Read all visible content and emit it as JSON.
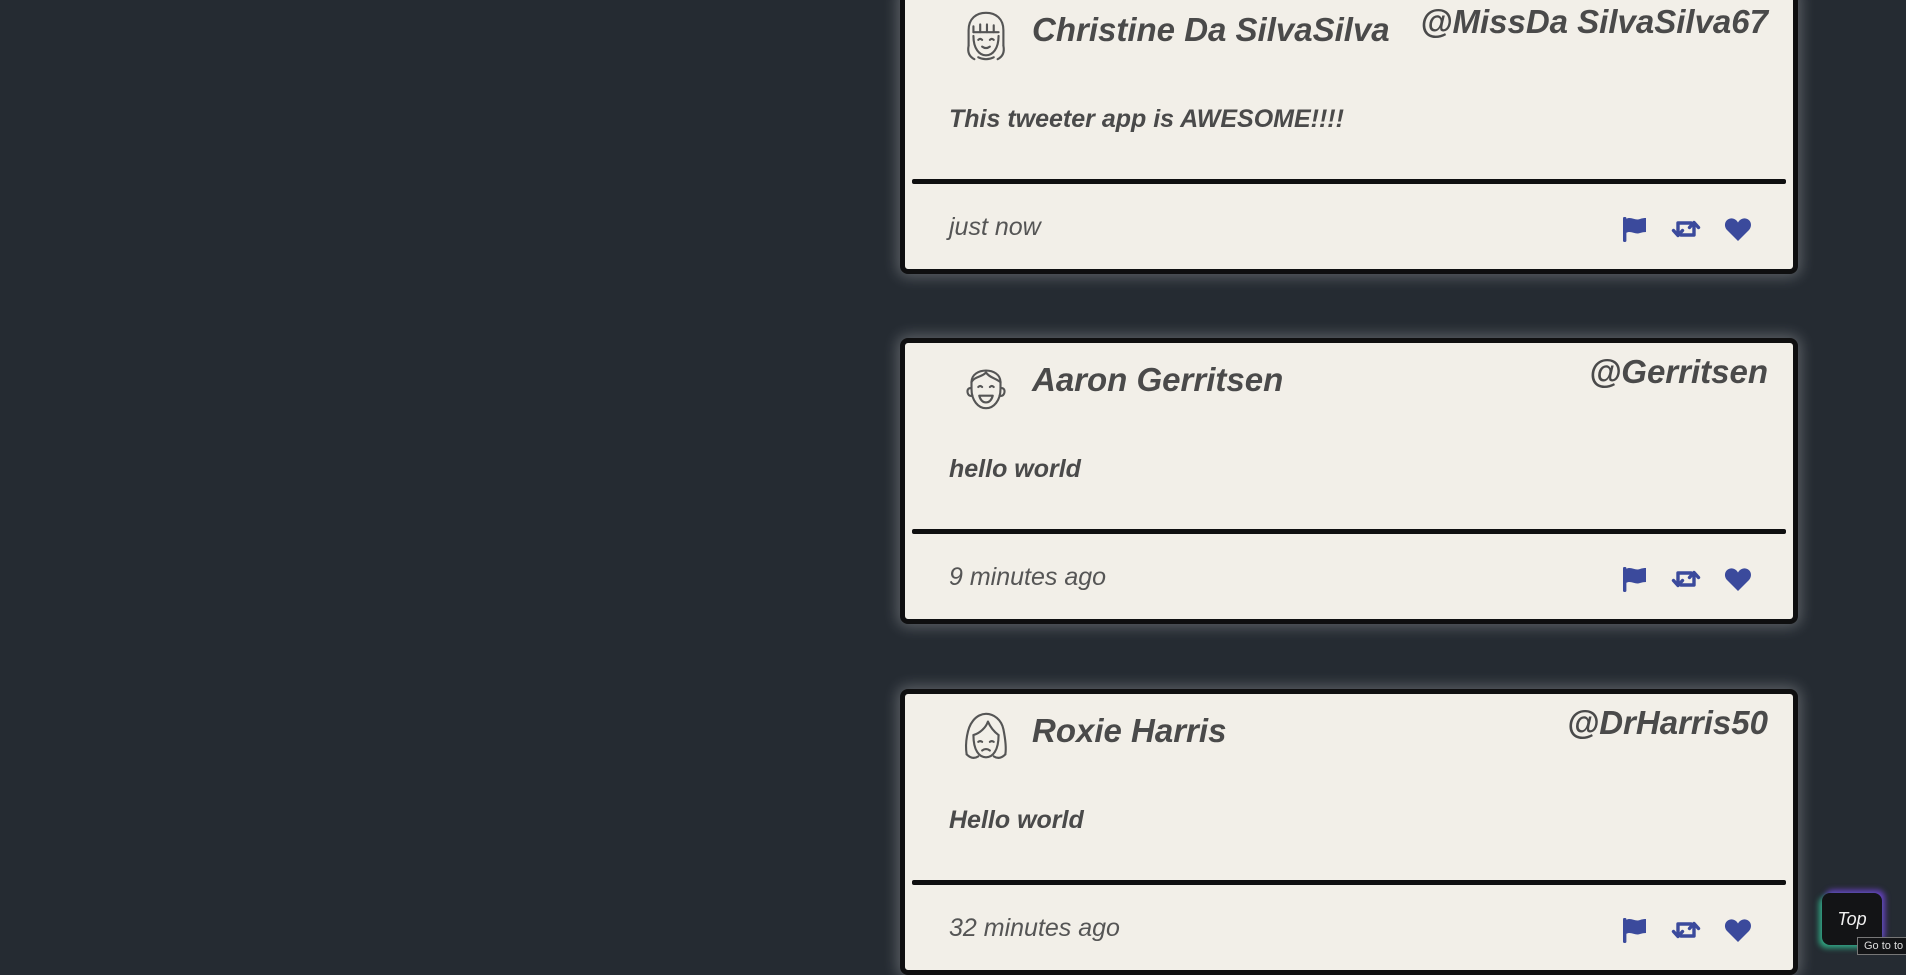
{
  "tweets": [
    {
      "avatar_icon": "girl-bangs-avatar-icon",
      "name": "Christine Da SilvaSilva",
      "handle": "@MissDa SilvaSilva67",
      "content": "This tweeter app is AWESOME!!!!",
      "timestamp": "just now"
    },
    {
      "avatar_icon": "smiling-boy-avatar-icon",
      "name": "Aaron Gerritsen",
      "handle": "@Gerritsen",
      "content": "hello world",
      "timestamp": "9 minutes ago"
    },
    {
      "avatar_icon": "girl-long-hair-avatar-icon",
      "name": "Roxie Harris",
      "handle": "@DrHarris50",
      "content": "Hello world",
      "timestamp": "32 minutes ago"
    }
  ],
  "actions": {
    "flag_icon": "flag-icon",
    "retweet_icon": "retweet-icon",
    "like_icon": "heart-icon",
    "color": "#3b4a9c"
  },
  "top_button": {
    "label": "Top",
    "tooltip": "Go to to"
  },
  "colors": {
    "background": "#252b32",
    "card": "#f2efe8",
    "text": "#4a4a4a"
  }
}
